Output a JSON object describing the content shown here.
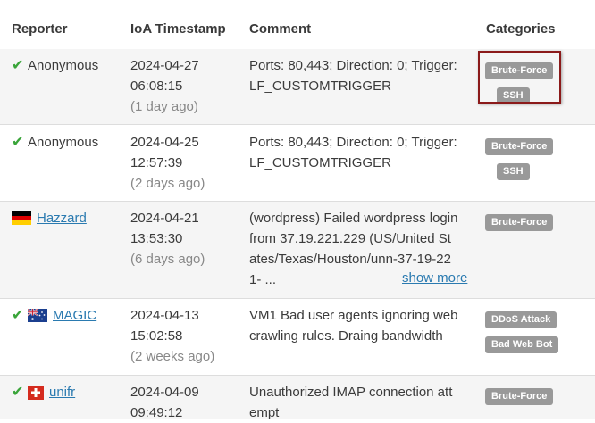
{
  "headers": {
    "reporter": "Reporter",
    "timestamp": "IoA Timestamp",
    "comment": "Comment",
    "categories": "Categories"
  },
  "rows": [
    {
      "reporter": "Anonymous",
      "reporter_icon": "check-icon",
      "date": "2024-04-27",
      "time": "06:08:15",
      "ago": "(1 day ago)",
      "comment_lines": [
        "Ports: 80,443; Direction: 0; Trigger:",
        "LF_CUSTOMTRIGGER"
      ],
      "categories": [
        "Brute-Force",
        "SSH"
      ]
    },
    {
      "reporter": "Anonymous",
      "reporter_icon": "check-icon",
      "date": "2024-04-25",
      "time": "12:57:39",
      "ago": "(2 days ago)",
      "comment_lines": [
        "Ports: 80,443; Direction: 0; Trigger:",
        "LF_CUSTOMTRIGGER"
      ],
      "categories": [
        "Brute-Force",
        "SSH"
      ]
    },
    {
      "reporter": "Hazzard",
      "reporter_icon": "germany-flag-icon",
      "date": "2024-04-21",
      "time": "13:53:30",
      "ago": "(6 days ago)",
      "comment_lines": [
        "(wordpress) Failed wordpress login",
        "from 37.19.221.229 (US/United St",
        "ates/Texas/Houston/unn-37-19-22",
        "1- ..."
      ],
      "show_more": "show more",
      "categories": [
        "Brute-Force"
      ]
    },
    {
      "reporter": "MAGIC",
      "reporter_icon": "australia-flag-icon",
      "date": "2024-04-13",
      "time": "15:02:58",
      "ago": "(2 weeks ago)",
      "comment_lines": [
        "VM1 Bad user agents ignoring web",
        "crawling rules. Draing bandwidth"
      ],
      "categories": [
        "DDoS Attack",
        "Bad Web Bot"
      ]
    },
    {
      "reporter": "unifr",
      "reporter_icon": "switzerland-flag-icon",
      "date": "2024-04-09",
      "time": "09:49:12",
      "ago": "",
      "comment_lines": [
        "Unauthorized IMAP connection att",
        "empt"
      ],
      "categories": [
        "Brute-Force"
      ]
    }
  ],
  "colors": {
    "badge": "#999999",
    "link": "#2a7ab0",
    "check": "#3aa53a",
    "highlight_border": "#8b1a1a",
    "row_shade": "#f5f5f5"
  }
}
